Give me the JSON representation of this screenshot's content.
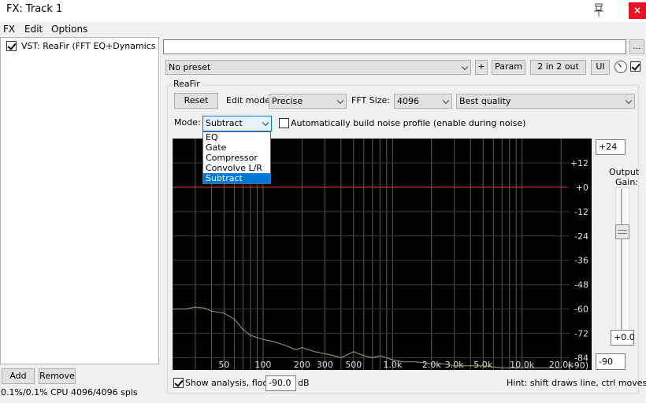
{
  "window": {
    "title": "FX: Track 1",
    "close_glyph": "×"
  },
  "menu": {
    "items": [
      "FX",
      "Edit",
      "Options"
    ]
  },
  "fx_list": {
    "items": [
      {
        "label": "VST: ReaFir (FFT EQ+Dynamics ...",
        "enabled": true
      }
    ]
  },
  "bottom_left": {
    "add_label": "Add",
    "remove_label": "Remove",
    "status": "0.1%/0.1% CPU 4096/4096 spls"
  },
  "top": {
    "name_value": "",
    "more_label": "...",
    "preset": "No preset",
    "plus_label": "+",
    "param_label": "Param",
    "io_label": "2 in 2 out",
    "ui_label": "UI",
    "enabled": true
  },
  "reafir": {
    "group_label": "ReaFir",
    "reset_label": "Reset",
    "edit_mode_label": "Edit mode:",
    "edit_mode_value": "Precise",
    "fft_label": "FFT Size:",
    "fft_value": "4096",
    "quality_value": "Best quality",
    "mode_label": "Mode:",
    "mode_value": "Subtract",
    "mode_options": [
      "EQ",
      "Gate",
      "Compressor",
      "Convolve L/R",
      "Subtract"
    ],
    "mode_selected_index": 4,
    "auto_noise_label": "Automatically build noise profile (enable during noise)",
    "auto_noise_checked": false,
    "show_analysis_label": "Show analysis, floor:",
    "show_analysis_checked": true,
    "floor_value": "-90.0",
    "floor_unit": "dB",
    "hint": "Hint: shift draws line, ctrl moves all",
    "output_gain_label_1": "Output",
    "output_gain_label_2": "Gain:",
    "range_top": "+24",
    "output_gain_value": "+0.0",
    "range_bottom": "-90",
    "output_gain_db": 0
  },
  "chart_data": {
    "type": "line",
    "xscale": "log",
    "x_ticks": [
      "50",
      "100",
      "200",
      "300",
      "500",
      "1.0k",
      "2.0k",
      "3.0k",
      "5.0k",
      "10.0k",
      "20.0k"
    ],
    "x_tick_values": [
      50,
      100,
      200,
      300,
      500,
      1000,
      2000,
      3000,
      5000,
      10000,
      20000
    ],
    "y_ticks": [
      "+12",
      "+0",
      "-12",
      "-24",
      "-36",
      "-48",
      "-60",
      "-72",
      "-84",
      "(-90)"
    ],
    "y_tick_values": [
      12,
      0,
      -12,
      -24,
      -36,
      -48,
      -60,
      -72,
      -84,
      -90
    ],
    "xlim": [
      20,
      22000
    ],
    "ylim": [
      -90,
      24
    ],
    "grid": true,
    "series": [
      {
        "role": "filter-curve",
        "color": "#e03030",
        "x": [
          20,
          22000
        ],
        "y": [
          0,
          0
        ]
      },
      {
        "role": "analysis",
        "color": "#a8a070",
        "x": [
          20,
          25,
          30,
          35,
          40,
          50,
          60,
          70,
          80,
          100,
          120,
          150,
          180,
          200,
          250,
          300,
          350,
          400,
          500,
          600,
          700,
          800,
          1000,
          1200,
          1500,
          2000,
          2500,
          3000,
          4000,
          5000,
          7000,
          10000,
          15000,
          20000
        ],
        "y": [
          -60,
          -60,
          -59,
          -59.5,
          -61,
          -62,
          -65,
          -70,
          -73,
          -75,
          -76,
          -78,
          -80,
          -79,
          -81,
          -82,
          -83,
          -84,
          -81,
          -83,
          -84,
          -83,
          -85,
          -86,
          -86,
          -87,
          -87,
          -88,
          -88,
          -88,
          -89,
          -89,
          -89,
          -89
        ]
      }
    ]
  }
}
